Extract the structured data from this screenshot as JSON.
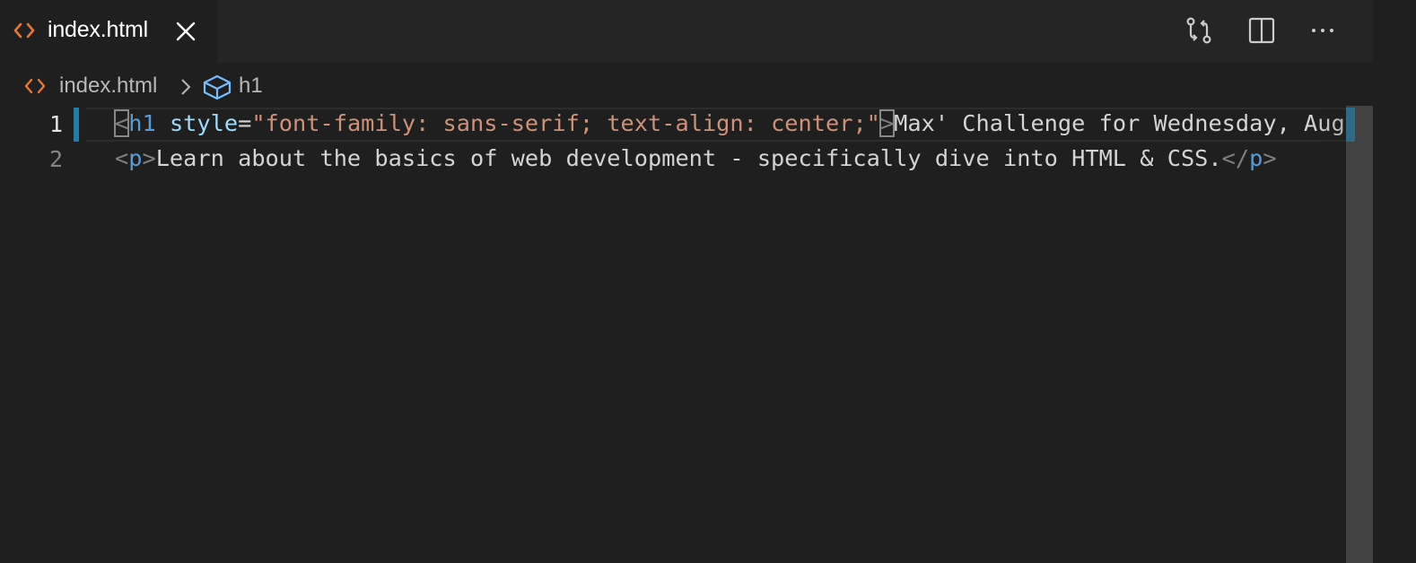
{
  "tab": {
    "label": "index.html",
    "icon": "html-code-icon",
    "close_icon": "close-icon"
  },
  "actions": [
    {
      "icon": "git-compare-icon"
    },
    {
      "icon": "split-editor-icon"
    },
    {
      "icon": "more-actions-icon",
      "glyph": "···"
    }
  ],
  "breadcrumb": {
    "file": "index.html",
    "separator_icon": "chevron-right-icon",
    "symbol_icon": "symbol-box-icon",
    "symbol": "h1"
  },
  "editor": {
    "line_numbers": [
      "1",
      "2"
    ],
    "lines": [
      [
        {
          "t": "<",
          "c": "punc"
        },
        {
          "t": "h1",
          "c": "tag"
        },
        {
          "t": " ",
          "c": "txt"
        },
        {
          "t": "style",
          "c": "attr"
        },
        {
          "t": "=",
          "c": "txt"
        },
        {
          "t": "\"font-family: sans-serif; text-align: center;\"",
          "c": "str"
        },
        {
          "t": ">",
          "c": "punc"
        },
        {
          "t": "Max' Challenge for Wednesday, Aug",
          "c": "txt"
        }
      ],
      [
        {
          "t": "<",
          "c": "punc"
        },
        {
          "t": "p",
          "c": "tag"
        },
        {
          "t": ">",
          "c": "punc"
        },
        {
          "t": "Learn about the basics of web development - specifically dive into HTML & CSS.",
          "c": "txt"
        },
        {
          "t": "</",
          "c": "punc"
        },
        {
          "t": "p",
          "c": "tag"
        },
        {
          "t": ">",
          "c": "punc"
        }
      ]
    ]
  },
  "colors": {
    "background": "#1f1f1f",
    "tag": "#569cd6",
    "attribute": "#9cdcfe",
    "string": "#ce9178",
    "file_icon": "#e37933",
    "symbol_icon": "#75beff"
  }
}
